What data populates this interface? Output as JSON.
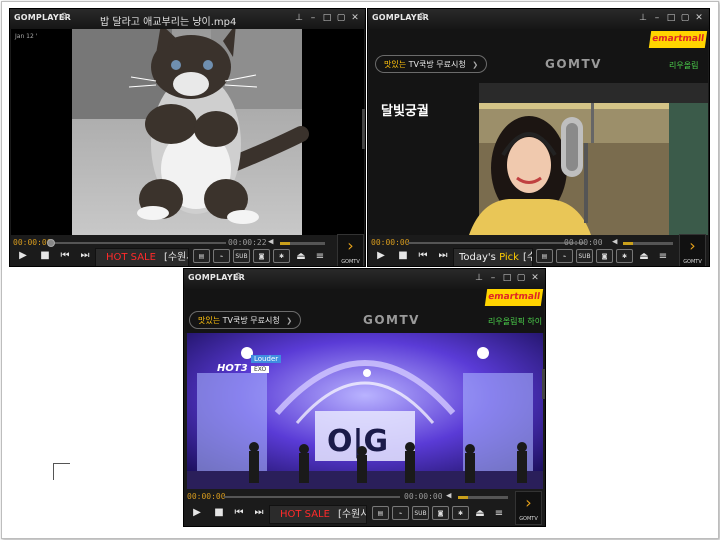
{
  "players": [
    {
      "app_logo": "GOMPLAYER",
      "title": "밥 달라고 애교부리는 냥이.mp4",
      "overlay_text": "Jan 12 '",
      "time_current": "00:00:00",
      "time_total": "00:00:22",
      "ticker_hot": "HOT SALE",
      "ticker_location": "[수원시]",
      "gomtv_button_label": "GOMTV",
      "video_kind": "cat"
    },
    {
      "app_logo": "GOMPLAYER",
      "title": "",
      "ad_brand": "emart",
      "ad_brand_suffix": "mall",
      "promo_text_yellow": "맛있는",
      "promo_text_rest": "TV쿡방 무료시청",
      "promo_arrow": "❯",
      "center_logo": "GOMTV",
      "green_text": "리우올림",
      "video_caption": "달빛궁궐",
      "time_current": "00:00:00",
      "time_total": "00:00:00",
      "ticker_pick_prefix": "Today's",
      "ticker_pick": "Pick",
      "ticker_location": "[수",
      "gomtv_button_label": "GOMTV",
      "video_kind": "singer"
    },
    {
      "app_logo": "GOMPLAYER",
      "title": "",
      "ad_brand": "emart",
      "ad_brand_suffix": "mall",
      "promo_text_yellow": "맛있는",
      "promo_text_rest": "TV쿡방 무료시청",
      "promo_arrow": "❯",
      "center_logo": "GOMTV",
      "green_text": "리우올림픽 하이",
      "video_overlay_hot": "HOT3",
      "video_overlay_song": "Louder",
      "video_overlay_artist": "EXO",
      "time_current": "00:00:00",
      "time_total": "00:00:00",
      "ticker_hot": "HOT SALE",
      "ticker_location": "[수원시]",
      "gomtv_button_label": "GOMTV",
      "video_kind": "stage"
    }
  ],
  "colors": {
    "accent_orange": "#e6a11a",
    "hot_red": "#ff2a2a",
    "promo_yellow": "#ffc20e",
    "green": "#4cd44c"
  }
}
